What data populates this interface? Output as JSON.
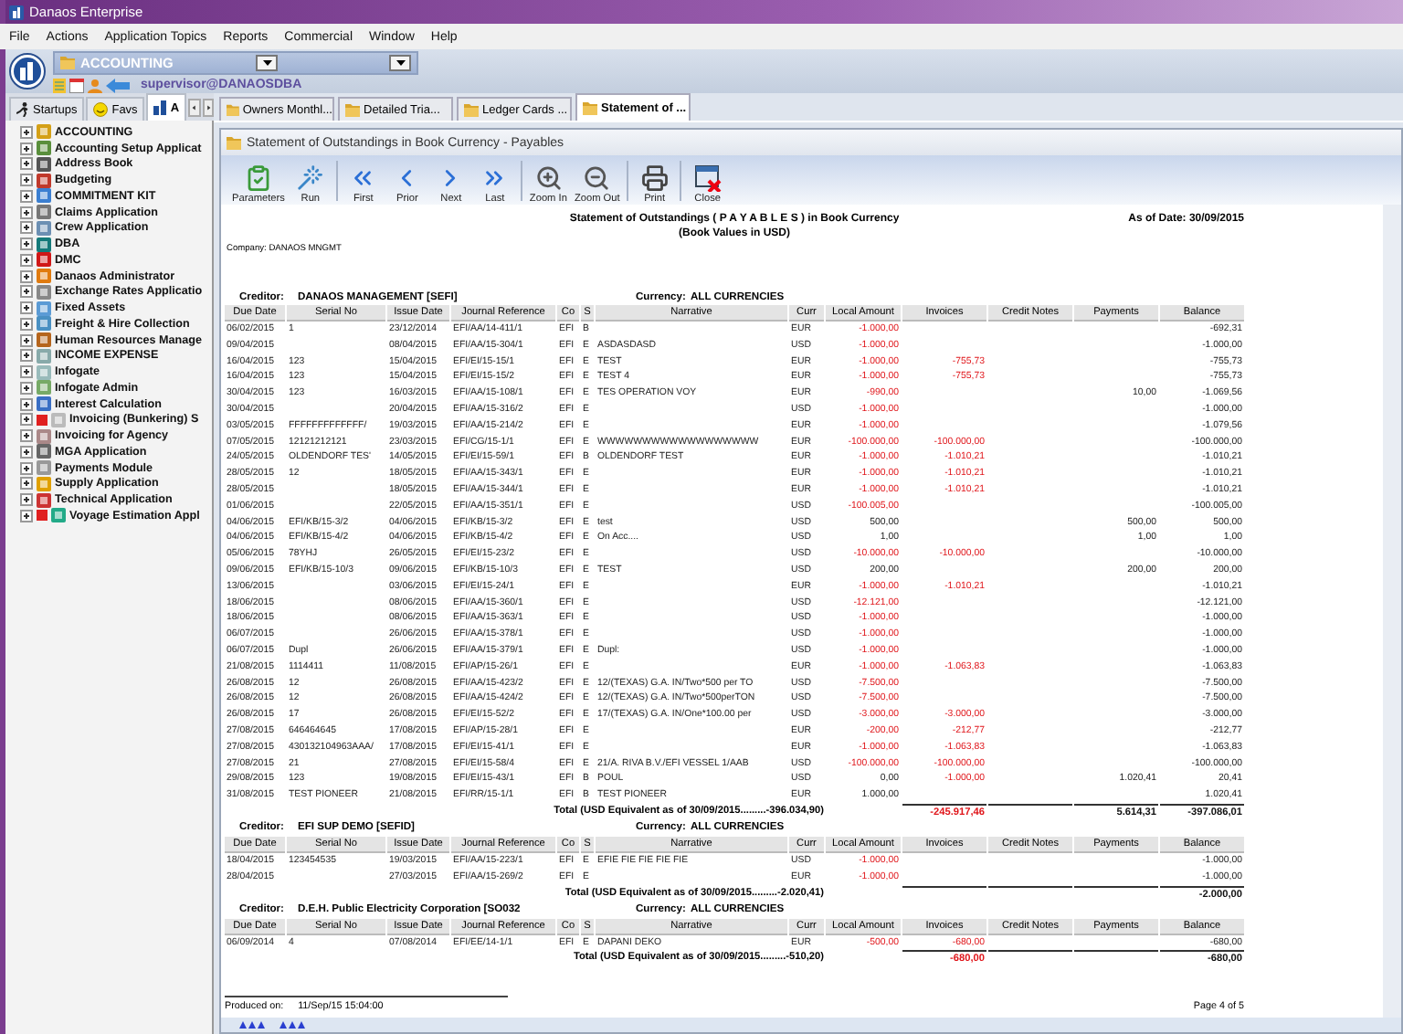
{
  "window": {
    "title": "Danaos Enterprise"
  },
  "menu": [
    "File",
    "Actions",
    "Application Topics",
    "Reports",
    "Commercial",
    "Window",
    "Help"
  ],
  "module_select": {
    "value": "ACCOUNTING"
  },
  "user": "supervisor@DANAOSDBA",
  "side_tabs": [
    {
      "label": "Startups",
      "selected": false
    },
    {
      "label": "Favs",
      "selected": false
    },
    {
      "label": "A",
      "selected": true
    }
  ],
  "side_items": [
    {
      "label": "ACCOUNTING",
      "expanded": false,
      "flagged": false
    },
    {
      "label": "Accounting Setup  Applicat",
      "expanded": false,
      "flagged": false
    },
    {
      "label": "Address Book",
      "expanded": false,
      "flagged": false
    },
    {
      "label": "Budgeting",
      "expanded": false,
      "flagged": false
    },
    {
      "label": "COMMITMENT KIT",
      "expanded": false,
      "flagged": false
    },
    {
      "label": "Claims Application",
      "expanded": false,
      "flagged": false
    },
    {
      "label": "Crew  Application",
      "expanded": false,
      "flagged": false
    },
    {
      "label": "DBA",
      "expanded": false,
      "flagged": false
    },
    {
      "label": "DMC",
      "expanded": false,
      "flagged": false
    },
    {
      "label": "Danaos Administrator",
      "expanded": false,
      "flagged": false
    },
    {
      "label": "Exchange Rates Applicatio",
      "expanded": false,
      "flagged": false
    },
    {
      "label": "Fixed Assets",
      "expanded": false,
      "flagged": false
    },
    {
      "label": "Freight & Hire Collection",
      "expanded": false,
      "flagged": false
    },
    {
      "label": "Human Resources Manage",
      "expanded": false,
      "flagged": false
    },
    {
      "label": "INCOME EXPENSE",
      "expanded": false,
      "flagged": false
    },
    {
      "label": "Infogate",
      "expanded": false,
      "flagged": false
    },
    {
      "label": "Infogate Admin",
      "expanded": false,
      "flagged": false
    },
    {
      "label": "Interest Calculation",
      "expanded": false,
      "flagged": false
    },
    {
      "label": "Invoicing (Bunkering) S",
      "expanded": false,
      "flagged": true
    },
    {
      "label": "Invoicing for Agency",
      "expanded": false,
      "flagged": false
    },
    {
      "label": "MGA  Application",
      "expanded": false,
      "flagged": false
    },
    {
      "label": "Payments Module",
      "expanded": false,
      "flagged": false
    },
    {
      "label": "Supply Application",
      "expanded": false,
      "flagged": false
    },
    {
      "label": "Technical Application",
      "expanded": false,
      "flagged": false
    },
    {
      "label": "Voyage Estimation Appl",
      "expanded": false,
      "flagged": true
    }
  ],
  "doc_tabs": [
    {
      "label": "Owners Monthl...",
      "selected": false
    },
    {
      "label": "Detailed Tria...",
      "selected": false
    },
    {
      "label": "Ledger Cards ...",
      "selected": false
    },
    {
      "label": "Statement of ...",
      "selected": true
    }
  ],
  "report_window": {
    "title": "Statement of Outstandings in Book Currency - Payables"
  },
  "toolbar": [
    {
      "kind": "parameters",
      "label": "Parameters"
    },
    {
      "kind": "run",
      "label": "Run"
    },
    {
      "kind": "first",
      "label": "First"
    },
    {
      "kind": "prior",
      "label": "Prior"
    },
    {
      "kind": "next",
      "label": "Next"
    },
    {
      "kind": "last",
      "label": "Last"
    },
    {
      "kind": "zoom_in",
      "label": "Zoom In"
    },
    {
      "kind": "zoom_out",
      "label": "Zoom Out"
    },
    {
      "kind": "print",
      "label": "Print"
    },
    {
      "kind": "close",
      "label": "Close"
    }
  ],
  "report": {
    "title": "Statement of Outstandings ( P A Y A B L E S ) in Book Currency",
    "as_of": "As of Date: 30/09/2015",
    "subtitle": "(Book Values in USD)",
    "company_label": "Company:",
    "company": "DANAOS MNGMT",
    "groups": [
      {
        "creditor_label": "Creditor:",
        "creditor": "DANAOS MANAGEMENT [SEFI]",
        "currency_label": "Currency:",
        "currency": "ALL CURRENCIES",
        "columns": [
          "Due Date",
          "Serial No",
          "Issue Date",
          "Journal Reference",
          "Co",
          "S",
          "Narrative",
          "Curr",
          "Local Amount",
          "Invoices",
          "Credit Notes",
          "Payments",
          "Balance"
        ],
        "rows": [
          {
            "due_date": "06/02/2015",
            "serial_no": "1",
            "issue_date": "23/12/2014",
            "journal_reference": "EFI/AA/14-411/1",
            "co": "EFI",
            "s": "B",
            "curr": "EUR",
            "local_amount": "-1.000,00",
            "balance": "-692,31"
          },
          {
            "due_date": "09/04/2015",
            "issue_date": "08/04/2015",
            "journal_reference": "EFI/AA/15-304/1",
            "co": "EFI",
            "s": "E",
            "narrative": "ASDASDASD",
            "curr": "USD",
            "local_amount": "-1.000,00",
            "balance": "-1.000,00"
          },
          {
            "due_date": "16/04/2015",
            "serial_no": "123",
            "issue_date": "15/04/2015",
            "journal_reference": "EFI/EI/15-15/1",
            "co": "EFI",
            "s": "E",
            "narrative": "TEST",
            "curr": "EUR",
            "local_amount": "-1.000,00",
            "invoices": "-755,73",
            "balance": "-755,73"
          },
          {
            "due_date": "16/04/2015",
            "serial_no": "123",
            "issue_date": "15/04/2015",
            "journal_reference": "EFI/EI/15-15/2",
            "co": "EFI",
            "s": "E",
            "narrative": "TEST 4",
            "curr": "EUR",
            "local_amount": "-1.000,00",
            "invoices": "-755,73",
            "balance": "-755,73"
          },
          {
            "due_date": "30/04/2015",
            "serial_no": "123",
            "issue_date": "16/03/2015",
            "journal_reference": "EFI/AA/15-108/1",
            "co": "EFI",
            "s": "E",
            "narrative": "TES OPERATION VOY",
            "curr": "EUR",
            "local_amount": "-990,00",
            "payments": "10,00",
            "balance": "-1.069,56"
          },
          {
            "due_date": "30/04/2015",
            "issue_date": "20/04/2015",
            "journal_reference": "EFI/AA/15-316/2",
            "co": "EFI",
            "s": "E",
            "curr": "USD",
            "local_amount": "-1.000,00",
            "balance": "-1.000,00"
          },
          {
            "due_date": "03/05/2015",
            "serial_no": "FFFFFFFFFFFFF/",
            "issue_date": "19/03/2015",
            "journal_reference": "EFI/AA/15-214/2",
            "co": "EFI",
            "s": "E",
            "curr": "EUR",
            "local_amount": "-1.000,00",
            "balance": "-1.079,56"
          },
          {
            "due_date": "07/05/2015",
            "serial_no": "12121212121",
            "issue_date": "23/03/2015",
            "journal_reference": "EFI/CG/15-1/1",
            "co": "EFI",
            "s": "E",
            "narrative": "WWWWWWWWWWWWWWWWWW",
            "curr": "EUR",
            "local_amount": "-100.000,00",
            "invoices": "-100.000,00",
            "balance": "-100.000,00"
          },
          {
            "due_date": "24/05/2015",
            "serial_no": "OLDENDORF TES'",
            "issue_date": "14/05/2015",
            "journal_reference": "EFI/EI/15-59/1",
            "co": "EFI",
            "s": "B",
            "narrative": "OLDENDORF TEST",
            "curr": "EUR",
            "local_amount": "-1.000,00",
            "invoices": "-1.010,21",
            "balance": "-1.010,21"
          },
          {
            "due_date": "28/05/2015",
            "serial_no": "12",
            "issue_date": "18/05/2015",
            "journal_reference": "EFI/AA/15-343/1",
            "co": "EFI",
            "s": "E",
            "curr": "EUR",
            "local_amount": "-1.000,00",
            "invoices": "-1.010,21",
            "balance": "-1.010,21"
          },
          {
            "due_date": "28/05/2015",
            "issue_date": "18/05/2015",
            "journal_reference": "EFI/AA/15-344/1",
            "co": "EFI",
            "s": "E",
            "curr": "EUR",
            "local_amount": "-1.000,00",
            "invoices": "-1.010,21",
            "balance": "-1.010,21"
          },
          {
            "due_date": "01/06/2015",
            "issue_date": "22/05/2015",
            "journal_reference": "EFI/AA/15-351/1",
            "co": "EFI",
            "s": "E",
            "curr": "USD",
            "local_amount": "-100.005,00",
            "balance": "-100.005,00"
          },
          {
            "due_date": "04/06/2015",
            "serial_no": "EFI/KB/15-3/2",
            "issue_date": "04/06/2015",
            "journal_reference": "EFI/KB/15-3/2",
            "co": "EFI",
            "s": "E",
            "narrative": "test",
            "curr": "USD",
            "local_amount": "500,00",
            "payments": "500,00",
            "balance": "500,00"
          },
          {
            "due_date": "04/06/2015",
            "serial_no": "EFI/KB/15-4/2",
            "issue_date": "04/06/2015",
            "journal_reference": "EFI/KB/15-4/2",
            "co": "EFI",
            "s": "E",
            "narrative": "On Acc....",
            "curr": "USD",
            "local_amount": "1,00",
            "payments": "1,00",
            "balance": "1,00"
          },
          {
            "due_date": "05/06/2015",
            "serial_no": "78YHJ",
            "issue_date": "26/05/2015",
            "journal_reference": "EFI/EI/15-23/2",
            "co": "EFI",
            "s": "E",
            "curr": "USD",
            "local_amount": "-10.000,00",
            "invoices": "-10.000,00",
            "balance": "-10.000,00"
          },
          {
            "due_date": "09/06/2015",
            "serial_no": "EFI/KB/15-10/3",
            "issue_date": "09/06/2015",
            "journal_reference": "EFI/KB/15-10/3",
            "co": "EFI",
            "s": "E",
            "narrative": "TEST",
            "curr": "USD",
            "local_amount": "200,00",
            "payments": "200,00",
            "balance": "200,00"
          },
          {
            "due_date": "13/06/2015",
            "issue_date": "03/06/2015",
            "journal_reference": "EFI/EI/15-24/1",
            "co": "EFI",
            "s": "E",
            "curr": "EUR",
            "local_amount": "-1.000,00",
            "invoices": "-1.010,21",
            "balance": "-1.010,21"
          },
          {
            "due_date": "18/06/2015",
            "issue_date": "08/06/2015",
            "journal_reference": "EFI/AA/15-360/1",
            "co": "EFI",
            "s": "E",
            "curr": "USD",
            "local_amount": "-12.121,00",
            "balance": "-12.121,00"
          },
          {
            "due_date": "18/06/2015",
            "issue_date": "08/06/2015",
            "journal_reference": "EFI/AA/15-363/1",
            "co": "EFI",
            "s": "E",
            "curr": "USD",
            "local_amount": "-1.000,00",
            "balance": "-1.000,00"
          },
          {
            "due_date": "06/07/2015",
            "issue_date": "26/06/2015",
            "journal_reference": "EFI/AA/15-378/1",
            "co": "EFI",
            "s": "E",
            "curr": "USD",
            "local_amount": "-1.000,00",
            "balance": "-1.000,00"
          },
          {
            "due_date": "06/07/2015",
            "serial_no": "Dupl",
            "issue_date": "26/06/2015",
            "journal_reference": "EFI/AA/15-379/1",
            "co": "EFI",
            "s": "E",
            "narrative": "Dupl:",
            "curr": "USD",
            "local_amount": "-1.000,00",
            "balance": "-1.000,00"
          },
          {
            "due_date": "21/08/2015",
            "serial_no": "1114411",
            "issue_date": "11/08/2015",
            "journal_reference": "EFI/AP/15-26/1",
            "co": "EFI",
            "s": "E",
            "curr": "EUR",
            "local_amount": "-1.000,00",
            "invoices": "-1.063,83",
            "balance": "-1.063,83"
          },
          {
            "due_date": "26/08/2015",
            "serial_no": "12",
            "issue_date": "26/08/2015",
            "journal_reference": "EFI/AA/15-423/2",
            "co": "EFI",
            "s": "E",
            "narrative": "12/(TEXAS) G.A. IN/Two*500 per TO",
            "curr": "USD",
            "local_amount": "-7.500,00",
            "balance": "-7.500,00"
          },
          {
            "due_date": "26/08/2015",
            "serial_no": "12",
            "issue_date": "26/08/2015",
            "journal_reference": "EFI/AA/15-424/2",
            "co": "EFI",
            "s": "E",
            "narrative": "12/(TEXAS) G.A. IN/Two*500perTON",
            "curr": "USD",
            "local_amount": "-7.500,00",
            "balance": "-7.500,00"
          },
          {
            "due_date": "26/08/2015",
            "serial_no": "17",
            "issue_date": "26/08/2015",
            "journal_reference": "EFI/EI/15-52/2",
            "co": "EFI",
            "s": "E",
            "narrative": "17/(TEXAS) G.A. IN/One*100.00 per",
            "curr": "USD",
            "local_amount": "-3.000,00",
            "invoices": "-3.000,00",
            "balance": "-3.000,00"
          },
          {
            "due_date": "27/08/2015",
            "serial_no": "646464645",
            "issue_date": "17/08/2015",
            "journal_reference": "EFI/AP/15-28/1",
            "co": "EFI",
            "s": "E",
            "curr": "EUR",
            "local_amount": "-200,00",
            "invoices": "-212,77",
            "balance": "-212,77"
          },
          {
            "due_date": "27/08/2015",
            "serial_no": "430132104963AAA/",
            "issue_date": "17/08/2015",
            "journal_reference": "EFI/EI/15-41/1",
            "co": "EFI",
            "s": "E",
            "curr": "EUR",
            "local_amount": "-1.000,00",
            "invoices": "-1.063,83",
            "balance": "-1.063,83"
          },
          {
            "due_date": "27/08/2015",
            "serial_no": "21",
            "issue_date": "27/08/2015",
            "journal_reference": "EFI/EI/15-58/4",
            "co": "EFI",
            "s": "E",
            "narrative": "21/A. RIVA B.V./EFI VESSEL 1/AAB",
            "curr": "USD",
            "local_amount": "-100.000,00",
            "invoices": "-100.000,00",
            "balance": "-100.000,00"
          },
          {
            "due_date": "29/08/2015",
            "serial_no": "123",
            "issue_date": "19/08/2015",
            "journal_reference": "EFI/EI/15-43/1",
            "co": "EFI",
            "s": "B",
            "narrative": "POUL",
            "curr": "USD",
            "local_amount": "0,00",
            "invoices": "-1.000,00",
            "payments": "1.020,41",
            "balance": "20,41"
          },
          {
            "due_date": "31/08/2015",
            "serial_no": "TEST PIONEER",
            "issue_date": "21/08/2015",
            "journal_reference": "EFI/RR/15-1/1",
            "co": "EFI",
            "s": "B",
            "narrative": "TEST PIONEER",
            "curr": "EUR",
            "local_amount": "1.000,00",
            "balance": "1.020,41"
          }
        ],
        "total": {
          "label": "Total (USD Equivalent as of 30/09/2015.........-396.034,90)",
          "invoices": "-245.917,46",
          "payments": "5.614,31",
          "balance": "-397.086,01"
        }
      },
      {
        "creditor_label": "Creditor:",
        "creditor": "EFI SUP DEMO [SEFID]",
        "currency_label": "Currency:",
        "currency": "ALL CURRENCIES",
        "columns": [
          "Due Date",
          "Serial No",
          "Issue Date",
          "Journal Reference",
          "Co",
          "S",
          "Narrative",
          "Curr",
          "Local Amount",
          "Invoices",
          "Credit Notes",
          "Payments",
          "Balance"
        ],
        "rows": [
          {
            "due_date": "18/04/2015",
            "serial_no": "123454535",
            "issue_date": "19/03/2015",
            "journal_reference": "EFI/AA/15-223/1",
            "co": "EFI",
            "s": "E",
            "narrative": "EFIE FIE FIE FIE FIE",
            "curr": "USD",
            "local_amount": "-1.000,00",
            "balance": "-1.000,00"
          },
          {
            "due_date": "28/04/2015",
            "issue_date": "27/03/2015",
            "journal_reference": "EFI/AA/15-269/2",
            "co": "EFI",
            "s": "E",
            "curr": "EUR",
            "local_amount": "-1.000,00",
            "balance": "-1.000,00"
          }
        ],
        "total": {
          "label": "Total (USD Equivalent as of 30/09/2015.........-2.020,41)",
          "balance": "-2.000,00"
        }
      },
      {
        "creditor_label": "Creditor:",
        "creditor": "D.E.H. Public Electricity Corporation  [SO032",
        "currency_label": "Currency:",
        "currency": "ALL CURRENCIES",
        "columns": [
          "Due Date",
          "Serial No",
          "Issue Date",
          "Journal Reference",
          "Co",
          "S",
          "Narrative",
          "Curr",
          "Local Amount",
          "Invoices",
          "Credit Notes",
          "Payments",
          "Balance"
        ],
        "rows": [
          {
            "due_date": "06/09/2014",
            "serial_no": "4",
            "issue_date": "07/08/2014",
            "journal_reference": "EFI/EE/14-1/1",
            "co": "EFI",
            "s": "E",
            "narrative": "DAPANI DEKO",
            "curr": "EUR",
            "local_amount": "-500,00",
            "invoices": "-680,00",
            "balance": "-680,00"
          }
        ],
        "total": {
          "label": "Total (USD Equivalent as of 30/09/2015.........-510,20)",
          "invoices": "-680,00",
          "balance": "-680,00"
        }
      }
    ],
    "produced_label": "Produced on:",
    "produced": "11/Sep/15 15:04:00",
    "page": "Page 4 of 5"
  }
}
